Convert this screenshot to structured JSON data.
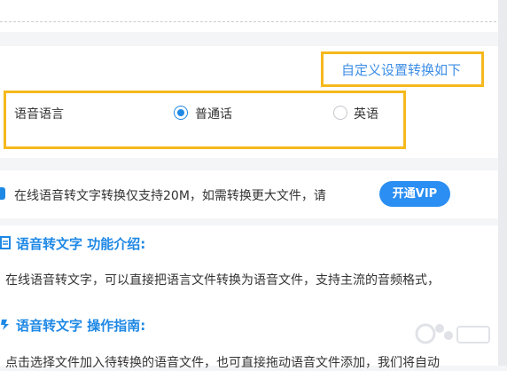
{
  "settings": {
    "custom_link": "自定义设置转换如下",
    "language_label": "语音语言",
    "options": [
      {
        "label": "普通话",
        "checked": true
      },
      {
        "label": "英语",
        "checked": false
      }
    ]
  },
  "notice": {
    "text": "在线语音转文字转换仅支持20M，如需转换更大文件，请",
    "vip_button": "开通VIP"
  },
  "intro": {
    "title": "语音转文字 功能介绍:",
    "text": "在线语音转文字，可以直接把语言文件转换为语音文件，支持主流的音频格式，"
  },
  "guide": {
    "title": "语音转文字 操作指南:",
    "text": "点击选择文件加入待转换的语音文件，也可直接拖动语音文件添加，我们将自动"
  },
  "colors": {
    "accent": "#1e88e5",
    "highlight_box": "#f6b81d",
    "vip_button": "#2b8ef2"
  },
  "icons": [
    "info-icon",
    "document-icon",
    "guide-icon",
    "radio-checked-icon",
    "radio-unchecked-icon"
  ]
}
